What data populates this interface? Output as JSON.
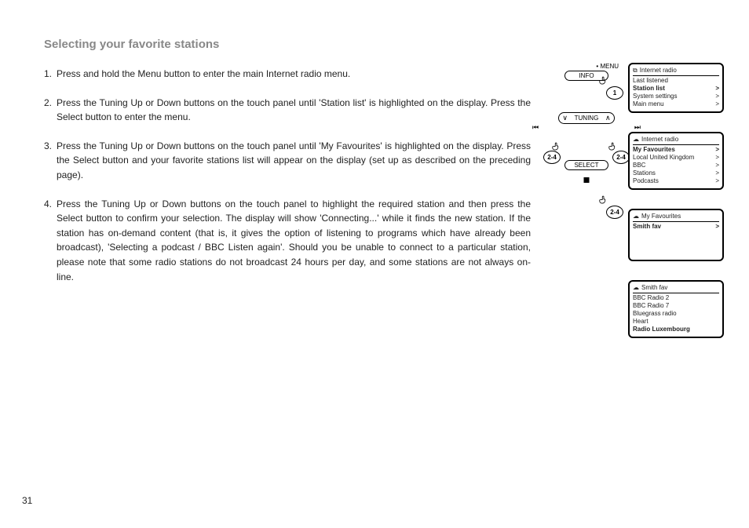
{
  "heading": "Selecting your favorite stations",
  "steps": [
    {
      "n": "1.",
      "t": "Press and hold the Menu button to enter the main Internet radio menu."
    },
    {
      "n": "2.",
      "t": "Press the Tuning Up or Down buttons on the touch panel until 'Station list' is highlighted on the display. Press the Select button to enter the menu."
    },
    {
      "n": "3.",
      "t": "Press the Tuning Up or Down buttons on the touch panel until 'My Favourites' is highlighted on the display. Press the Select button and your favorite stations list will appear on the display (set up as described on the preceding page)."
    },
    {
      "n": "4.",
      "t": "Press the Tuning Up or Down buttons on the touch panel to highlight the required station and then press the Select button to confirm your selection. The display will show 'Connecting...' while it finds the new station. If the station has on-demand content (that is, it gives the option of listening to programs which have already been broadcast), 'Selecting a podcast / BBC Listen again'. Should you be unable to connect to a particular station, please note that some radio stations do not broadcast 24 hours per day, and some stations are not always on-line."
    }
  ],
  "pageNumber": "31",
  "diagram": {
    "menuLabel": "• MENU",
    "infoLabel": "INFO",
    "tuningLabel": "TUNING",
    "selectLabel": "SELECT",
    "skipBack": "⏮",
    "skipFwd": "⏭",
    "bubble1": "1",
    "bubble24a": "2-4",
    "bubble24b": "2-4",
    "bubble24c": "2-4"
  },
  "screens": [
    {
      "icon": "⧉",
      "title": "Internet radio",
      "rows": [
        {
          "label": "Last listened",
          "arrow": ""
        },
        {
          "label": "Station list",
          "arrow": ">",
          "bold": true
        },
        {
          "label": "System settings",
          "arrow": ">"
        },
        {
          "label": "Main menu",
          "arrow": ">"
        }
      ]
    },
    {
      "icon": "☁",
      "title": "Internet radio",
      "rows": [
        {
          "label": "My Favourites",
          "arrow": ">",
          "bold": true
        },
        {
          "label": "Local United Kingdom",
          "arrow": ">"
        },
        {
          "label": "BBC",
          "arrow": ">"
        },
        {
          "label": "Stations",
          "arrow": ">"
        },
        {
          "label": "Podcasts",
          "arrow": ">"
        }
      ]
    },
    {
      "icon": "☁",
      "title": "My Favourites",
      "tall": true,
      "rows": [
        {
          "label": "Smith fav",
          "arrow": ">",
          "bold": true
        }
      ]
    },
    {
      "icon": "☁",
      "title": "Smith fav",
      "rows": [
        {
          "label": "BBC Radio 2",
          "arrow": ""
        },
        {
          "label": "BBC Radio 7",
          "arrow": ""
        },
        {
          "label": "Bluegrass radio",
          "arrow": ""
        },
        {
          "label": "Heart",
          "arrow": ""
        },
        {
          "label": "Radio Luxembourg",
          "arrow": "",
          "bold": true
        }
      ]
    }
  ]
}
